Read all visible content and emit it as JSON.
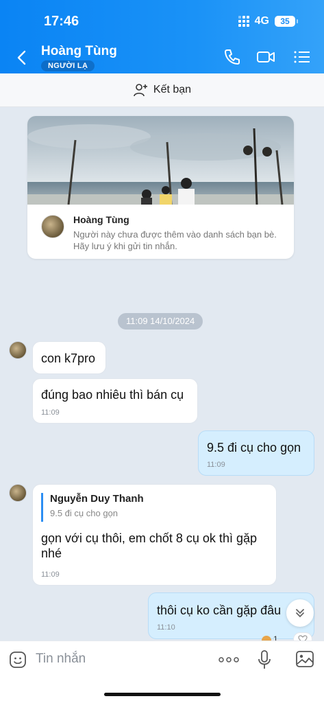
{
  "status_bar": {
    "time": "17:46",
    "network": "4G",
    "battery": "35"
  },
  "header": {
    "contact_name": "Hoàng Tùng",
    "badge": "NGƯỜI LẠ"
  },
  "add_friend": {
    "label": "Kết bạn"
  },
  "profile_card": {
    "name": "Hoàng Tùng",
    "note": "Người này chưa được thêm vào danh sách bạn bè. Hãy lưu ý khi gửi tin nhắn."
  },
  "date_separator": "11:09 14/10/2024",
  "messages": [
    {
      "side": "received",
      "text": "con k7pro",
      "time": ""
    },
    {
      "side": "received",
      "text": "đúng bao nhiêu thì bán cụ",
      "time": "11:09"
    },
    {
      "side": "sent",
      "text": "9.5 đi cụ cho gọn",
      "time": "11:09"
    },
    {
      "side": "received",
      "quote_name": "Nguyễn Duy Thanh",
      "quote_text": "9.5 đi cụ cho gọn",
      "text": "gọn với cụ thôi, em chốt 8 cụ ok thì gặp nhé",
      "time": "11:09"
    },
    {
      "side": "sent",
      "text": "thôi cụ ko cần gặp đâu",
      "time": "11:10"
    }
  ],
  "reactions": {
    "count": "1"
  },
  "composer": {
    "placeholder": "Tin nhắn"
  },
  "colors": {
    "header_start": "#0a84f4",
    "header_end": "#34a2f9",
    "sent_bubble": "#d5eefe",
    "accent": "#2b8ef3"
  }
}
